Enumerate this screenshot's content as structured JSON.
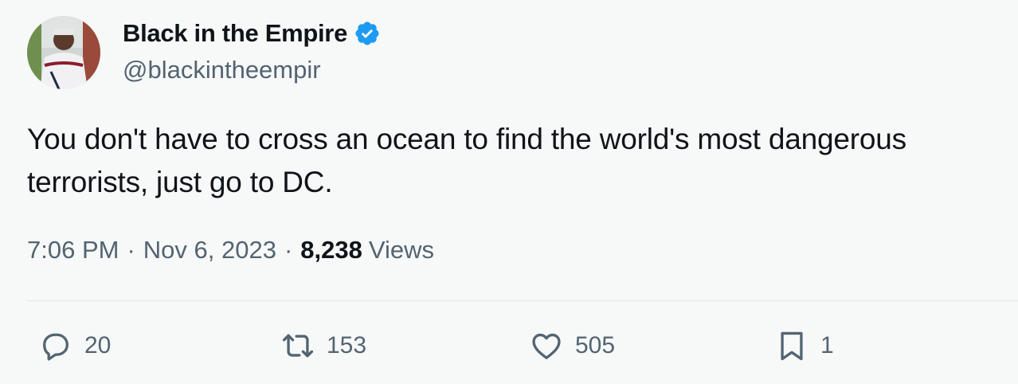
{
  "user": {
    "display_name": "Black in the Empire",
    "handle": "@blackintheempir",
    "verified": true,
    "verified_color": "#1d9bf0"
  },
  "tweet": {
    "text_line1": "You don't have to cross an ocean to find the world's most dangerous",
    "text_line2": "terrorists, just go to DC.",
    "time": "7:06 PM",
    "date": "Nov 6, 2023",
    "separator": "·",
    "views_count": "8,238",
    "views_label": "Views"
  },
  "actions": {
    "replies": {
      "icon": "reply-icon",
      "count": "20"
    },
    "retweets": {
      "icon": "retweet-icon",
      "count": "153"
    },
    "likes": {
      "icon": "heart-icon",
      "count": "505"
    },
    "bookmarks": {
      "icon": "bookmark-icon",
      "count": "1"
    }
  },
  "colors": {
    "text": "#0f1419",
    "secondary": "#536471",
    "background": "#f7f8f8",
    "divider": "#e1e6e9"
  }
}
